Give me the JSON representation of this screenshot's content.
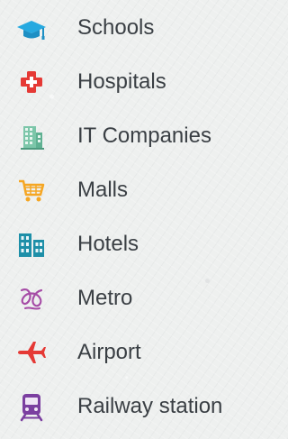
{
  "legend": {
    "items": [
      {
        "label": "Schools",
        "icon": "graduation-cap-icon",
        "color": "#26a9e0"
      },
      {
        "label": "Hospitals",
        "icon": "hospital-cross-icon",
        "color": "#e53935"
      },
      {
        "label": "IT Companies",
        "icon": "office-building-icon",
        "color": "#7cc6a9"
      },
      {
        "label": "Malls",
        "icon": "shopping-cart-icon",
        "color": "#f5a623"
      },
      {
        "label": "Hotels",
        "icon": "hotel-buildings-icon",
        "color": "#1d8fa8"
      },
      {
        "label": "Metro",
        "icon": "metro-logo-icon",
        "color": "#a64ca6"
      },
      {
        "label": "Airport",
        "icon": "airplane-icon",
        "color": "#e53935"
      },
      {
        "label": "Railway station",
        "icon": "train-icon",
        "color": "#7b3fa0"
      }
    ]
  }
}
